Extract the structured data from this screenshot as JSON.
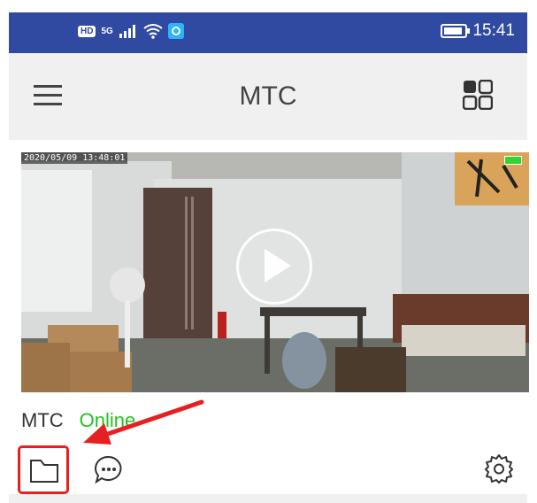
{
  "status_bar": {
    "hd_badge": "HD",
    "signal": "5G",
    "time": "15:41",
    "battery_level": 0.9
  },
  "app_bar": {
    "title": "MTC",
    "menu_icon": "hamburger-menu-icon",
    "layout_icon": "grid-view-icon"
  },
  "camera_card": {
    "timestamp": "2020/05/09 13:48:01",
    "play_icon": "play-icon",
    "device_name": "MTC",
    "status": "Online",
    "status_color": "#24c21f",
    "actions": {
      "folder_icon": "folder-icon",
      "message_icon": "message-bubble-icon",
      "settings_icon": "gear-icon"
    }
  },
  "annotation": {
    "highlight_color": "#e62020"
  }
}
